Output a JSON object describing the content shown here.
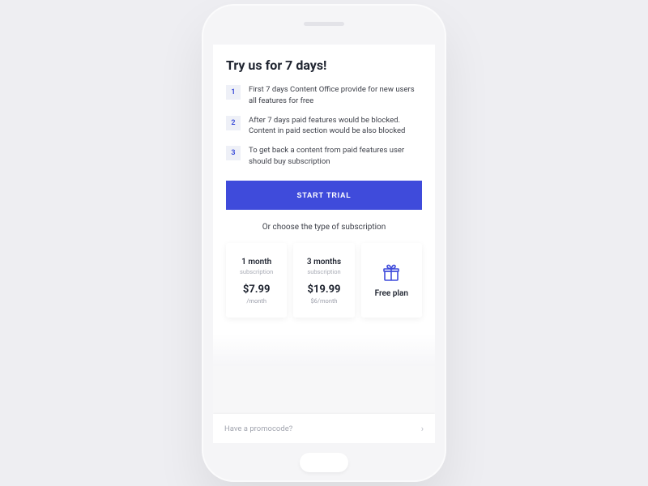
{
  "title": "Try us for 7 days!",
  "steps": [
    {
      "n": "1",
      "text": "First 7 days Content Office provide for new users all features for free"
    },
    {
      "n": "2",
      "text": "After 7 days paid features would be blocked. Content in paid section would be also blocked"
    },
    {
      "n": "3",
      "text": "To get back a content from paid features user should buy subscription"
    }
  ],
  "cta_label": "START TRIAL",
  "choose_label": "Or choose the type of subscription",
  "plans": {
    "one_month": {
      "title": "1 month",
      "sub": "subscription",
      "price": "$7.99",
      "rate": "/month"
    },
    "three_months": {
      "title": "3 months",
      "sub": "subscription",
      "price": "$19.99",
      "rate": "$6/month"
    },
    "free": {
      "label": "Free plan"
    }
  },
  "promo": {
    "label": "Have a promocode?"
  },
  "colors": {
    "accent": "#3f4bdb"
  }
}
